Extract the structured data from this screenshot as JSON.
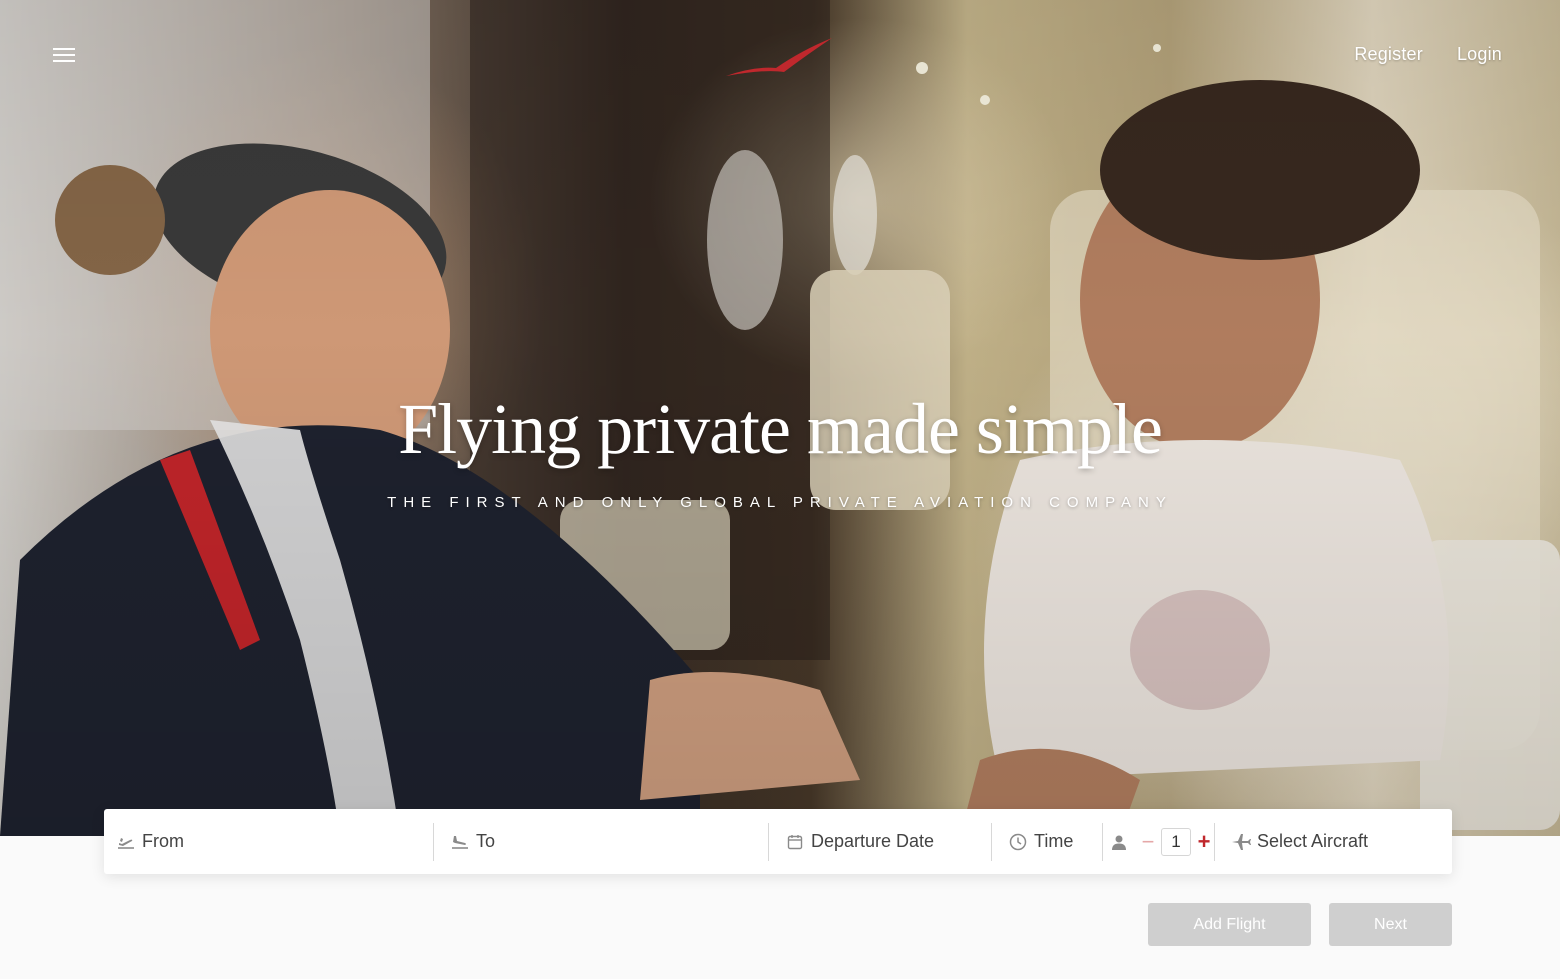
{
  "header": {
    "menu_icon": "hamburger-icon",
    "logo_icon": "bird-logo-icon",
    "nav": [
      {
        "label": "Register"
      },
      {
        "label": "Login"
      }
    ]
  },
  "hero": {
    "title": "Flying private made simple",
    "subtitle": "THE FIRST AND ONLY GLOBAL PRIVATE AVIATION COMPANY"
  },
  "search": {
    "from_label": "From",
    "to_label": "To",
    "date_label": "Departure Date",
    "time_label": "Time",
    "passengers": {
      "minus": "−",
      "value": "1",
      "plus": "+"
    },
    "aircraft_label": "Select Aircraft"
  },
  "actions": {
    "add_flight": "Add Flight",
    "next": "Next"
  },
  "colors": {
    "brand_red": "#c0282d",
    "button_disabled": "#cfcfcf"
  }
}
